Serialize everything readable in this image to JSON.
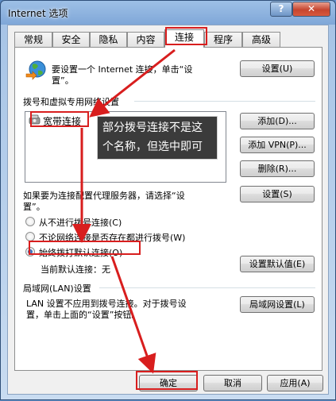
{
  "window": {
    "title": "Internet 选项",
    "help_label": "?",
    "close_label": "✕"
  },
  "tabs": [
    {
      "label": "常规"
    },
    {
      "label": "安全"
    },
    {
      "label": "隐私"
    },
    {
      "label": "内容"
    },
    {
      "label": "连接"
    },
    {
      "label": "程序"
    },
    {
      "label": "高级"
    }
  ],
  "setup": {
    "line1": "要设置一个 Internet 连接，单击“设",
    "line2": "置”。",
    "button": "设置(U)"
  },
  "dialup": {
    "heading": "拨号和虚拟专用网络设置",
    "items": [
      {
        "label": "宽带连接"
      }
    ],
    "add_button": "添加(D)...",
    "add_vpn_button": "添加 VPN(P)...",
    "remove_button": "删除(R)...",
    "proxy_line1": "如果要为连接配置代理服务器，请选择“设",
    "proxy_line2": "置”。",
    "settings_button": "设置(S)",
    "options": [
      {
        "label": "从不进行拨号连接(C)",
        "checked": false
      },
      {
        "label": "不论网络连接是否存在都进行拨号(W)",
        "checked": false
      },
      {
        "label": "始终拨打默认连接(O)",
        "checked": true
      }
    ],
    "current_default": "当前默认连接：无",
    "set_default_button": "设置默认值(E)"
  },
  "lan": {
    "heading": "局域网(LAN)设置",
    "line1": "LAN 设置不应用到拨号连接。对于拨号设",
    "line2": "置，单击上面的“设置”按钮。",
    "button": "局域网设置(L)"
  },
  "footer": {
    "ok": "确定",
    "cancel": "取消",
    "apply": "应用(A)"
  },
  "annotation": {
    "line1": "部分拨号连接不是这",
    "line2": "个名称，但选中即可"
  },
  "colors": {
    "annotation_red": "#d81e1e",
    "accent": "#1b4f9a"
  }
}
